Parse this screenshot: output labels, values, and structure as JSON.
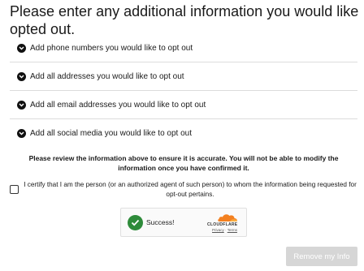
{
  "title": "Please enter any additional information you would like opted out.",
  "sections": [
    {
      "label": "Add phone numbers you would like to opt out"
    },
    {
      "label": "Add all addresses you would like to opt out"
    },
    {
      "label": "Add all email addresses you would like to opt out"
    },
    {
      "label": "Add all social media you would like to opt out"
    }
  ],
  "notice": "Please review the information above to ensure it is accurate. You will not be able to modify the information once you have confirmed it.",
  "certify_text": "I certify that I am the person (or an authorized agent of such person) to whom the information being requested for opt-out pertains.",
  "certify_checked": false,
  "captcha": {
    "status": "Success!",
    "brand": "CLOUDFLARE",
    "privacy": "Privacy",
    "separator": "·",
    "terms": "Terms",
    "success_color": "#2e8b3a",
    "brand_color": "#f38020"
  },
  "remove_button": {
    "label": "Remove my Info",
    "disabled": true,
    "color": "#d6d6d6"
  }
}
